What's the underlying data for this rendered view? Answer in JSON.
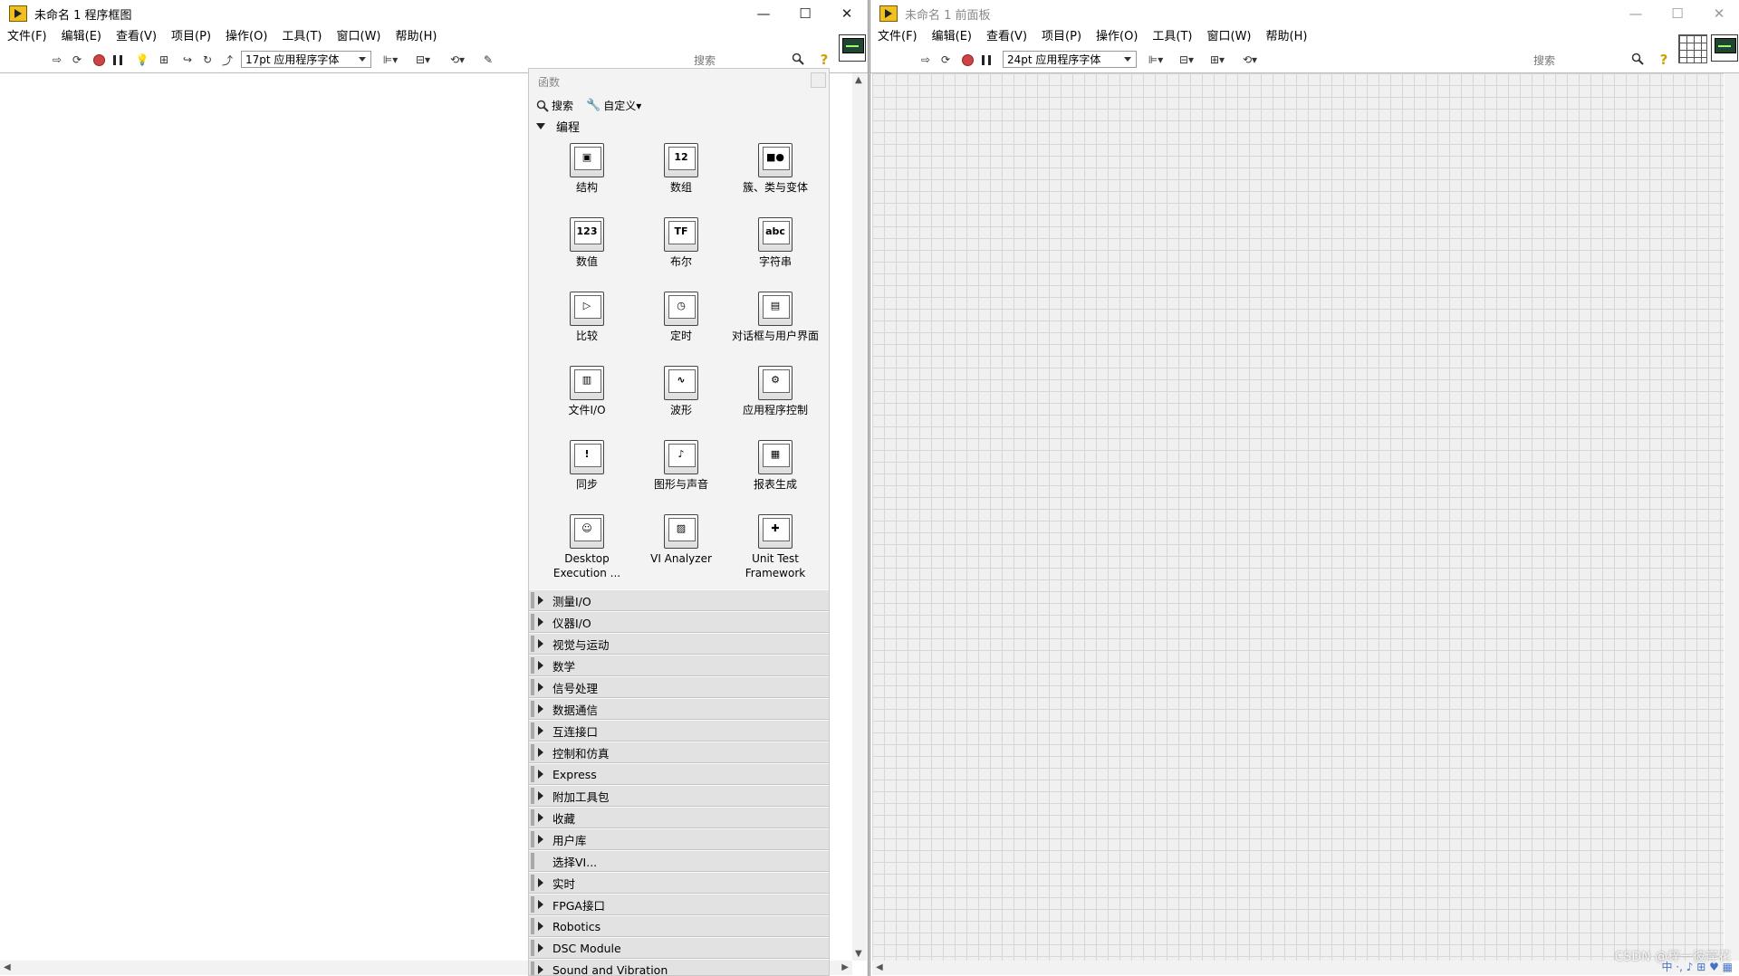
{
  "left_window": {
    "title": "未命名 1 程序框图",
    "menu": [
      "文件(F)",
      "编辑(E)",
      "查看(V)",
      "项目(P)",
      "操作(O)",
      "工具(T)",
      "窗口(W)",
      "帮助(H)"
    ],
    "font_select": "17pt 应用程序字体",
    "search_placeholder": "搜索",
    "window_controls": {
      "minimize": "—",
      "maximize": "☐",
      "close": "✕"
    }
  },
  "right_window": {
    "title": "未命名 1 前面板",
    "menu": [
      "文件(F)",
      "编辑(E)",
      "查看(V)",
      "项目(P)",
      "操作(O)",
      "工具(T)",
      "窗口(W)",
      "帮助(H)"
    ],
    "font_select": "24pt 应用程序字体",
    "search_placeholder": "搜索",
    "window_controls": {
      "minimize": "—",
      "maximize": "☐",
      "close": "✕"
    }
  },
  "palette": {
    "title": "函数",
    "search_label": "搜索",
    "customize_label": "自定义▾",
    "open_category": "编程",
    "items": [
      {
        "label": "结构",
        "glyph": "▣"
      },
      {
        "label": "数组",
        "glyph": "12"
      },
      {
        "label": "簇、类与变体",
        "glyph": "■●"
      },
      {
        "label": "数值",
        "glyph": "123"
      },
      {
        "label": "布尔",
        "glyph": "TF"
      },
      {
        "label": "字符串",
        "glyph": "abc"
      },
      {
        "label": "比较",
        "glyph": "▷"
      },
      {
        "label": "定时",
        "glyph": "◷"
      },
      {
        "label": "对话框与用户界面",
        "glyph": "▤"
      },
      {
        "label": "文件I/O",
        "glyph": "▥"
      },
      {
        "label": "波形",
        "glyph": "∿"
      },
      {
        "label": "应用程序控制",
        "glyph": "⚙"
      },
      {
        "label": "同步",
        "glyph": "!"
      },
      {
        "label": "图形与声音",
        "glyph": "♪"
      },
      {
        "label": "报表生成",
        "glyph": "▦"
      },
      {
        "label": "Desktop Execution ...",
        "glyph": "☺"
      },
      {
        "label": "VI Analyzer",
        "glyph": "▨"
      },
      {
        "label": "Unit Test Framework",
        "glyph": "✚"
      }
    ],
    "categories": [
      {
        "label": "测量I/O",
        "expandable": true
      },
      {
        "label": "仪器I/O",
        "expandable": true
      },
      {
        "label": "视觉与运动",
        "expandable": true
      },
      {
        "label": "数学",
        "expandable": true
      },
      {
        "label": "信号处理",
        "expandable": true
      },
      {
        "label": "数据通信",
        "expandable": true
      },
      {
        "label": "互连接口",
        "expandable": true
      },
      {
        "label": "控制和仿真",
        "expandable": true
      },
      {
        "label": "Express",
        "expandable": true
      },
      {
        "label": "附加工具包",
        "expandable": true
      },
      {
        "label": "收藏",
        "expandable": true
      },
      {
        "label": "用户库",
        "expandable": true
      },
      {
        "label": "选择VI...",
        "expandable": false
      },
      {
        "label": "实时",
        "expandable": true
      },
      {
        "label": "FPGA接口",
        "expandable": true
      },
      {
        "label": "Robotics",
        "expandable": true
      },
      {
        "label": "DSC Module",
        "expandable": true
      },
      {
        "label": "Sound and Vibration",
        "expandable": true
      }
    ]
  },
  "watermark": "CSDN @梓一彼岸花",
  "tray_text": "中 ·, ♪ ⊞ ♥ ▦"
}
